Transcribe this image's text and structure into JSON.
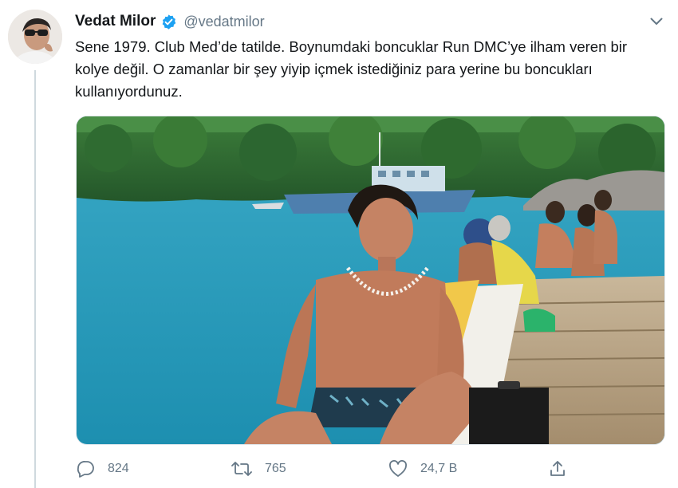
{
  "tweet": {
    "author": {
      "display_name": "Vedat Milor",
      "handle": "@vedatmilor",
      "verified": true,
      "avatar_icon": "profile-photo"
    },
    "text": "Sene 1979. Club Med’de tatilde. Boynumdaki boncuklar Run DMC’ye ilham veren bir kolye değil. O zamanlar bir şey yiyip içmek istediğiniz para yerine bu boncukları kullanıyordunuz.",
    "media": {
      "kind": "photo",
      "description_icon": "vintage-beach-photo"
    },
    "actions": {
      "reply": {
        "icon": "reply-icon",
        "count": "824"
      },
      "retweet": {
        "icon": "retweet-icon",
        "count": "765"
      },
      "like": {
        "icon": "heart-icon",
        "count": "24,7 B"
      },
      "share": {
        "icon": "share-icon"
      }
    },
    "menu_icon": "chevron-down-icon"
  },
  "colors": {
    "text": "#14171a",
    "secondary": "#657786",
    "verified_blue": "#1da1f2",
    "thread_line": "#cfd9de"
  }
}
